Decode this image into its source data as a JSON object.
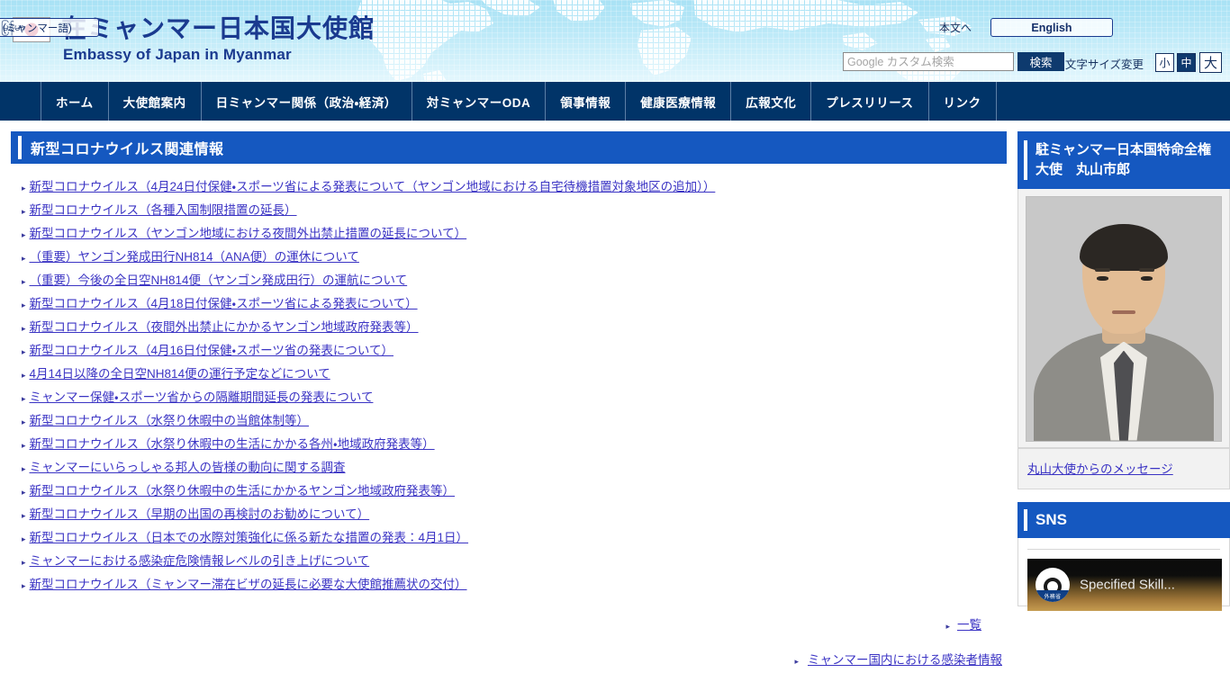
{
  "header": {
    "flag_icon": "japan-flag-icon",
    "title_ja": "在ミャンマー日本国大使館",
    "title_en": "Embassy of Japan in Myanmar",
    "skip_link": "本文へ",
    "lang_english": "English",
    "lang_myanmar_native": "မြန်မာ",
    "lang_myanmar_jp": "(ミャンマー語)",
    "search_placeholder": "Google カスタム検索",
    "search_value": "",
    "search_button": "検索",
    "fontsize_label": "文字サイズ変更",
    "fontsize_small": "小",
    "fontsize_medium": "中",
    "fontsize_large": "大",
    "accent_blue": "#013468",
    "header_bg": "#b9e8f7"
  },
  "nav": {
    "items": [
      {
        "label": "ホーム"
      },
      {
        "label": "大使館案内"
      },
      {
        "label": "日ミャンマー関係（政治・経済）"
      },
      {
        "label": "対ミャンマーODA"
      },
      {
        "label": "領事情報"
      },
      {
        "label": "健康医療情報"
      },
      {
        "label": "広報文化"
      },
      {
        "label": "プレスリリース"
      },
      {
        "label": "リンク"
      }
    ]
  },
  "main": {
    "section_title": "新型コロナウイルス関連情報",
    "section_color": "#1558c0",
    "news": [
      {
        "label": "新型コロナウイルス（4月24日付保健・スポーツ省による発表について（ヤンゴン地域における自宅待機措置対象地区の追加））"
      },
      {
        "label": "新型コロナウイルス（各種入国制限措置の延長）"
      },
      {
        "label": "新型コロナウイルス（ヤンゴン地域における夜間外出禁止措置の延長について）"
      },
      {
        "label": "（重要）ヤンゴン発成田行NH814（ANA便）の運休について"
      },
      {
        "label": "（重要）今後の全日空NH814便（ヤンゴン発成田行）の運航について"
      },
      {
        "label": "新型コロナウイルス（4月18日付保健・スポーツ省による発表について）"
      },
      {
        "label": "新型コロナウイルス（夜間外出禁止にかかるヤンゴン地域政府発表等）"
      },
      {
        "label": "新型コロナウイルス（4月16日付保健・スポーツ省の発表について）"
      },
      {
        "label": "4月14日以降の全日空NH814便の運行予定などについて"
      },
      {
        "label": "ミャンマー保健・スポーツ省からの隔離期間延長の発表について"
      },
      {
        "label": "新型コロナウイルス（水祭り休暇中の当館体制等）"
      },
      {
        "label": "新型コロナウイルス（水祭り休暇中の生活にかかる各州・地域政府発表等）"
      },
      {
        "label": "ミャンマーにいらっしゃる邦人の皆様の動向に関する調査"
      },
      {
        "label": "新型コロナウイルス（水祭り休暇中の生活にかかるヤンゴン地域政府発表等）"
      },
      {
        "label": "新型コロナウイルス（早期の出国の再検討のお勧めについて）"
      },
      {
        "label": "新型コロナウイルス（日本での水際対策強化に係る新たな措置の発表：4月1日）"
      },
      {
        "label": "ミャンマーにおける感染症危険情報レベルの引き上げについて"
      },
      {
        "label": "新型コロナウイルス（ミャンマー滞在ビザの延長に必要な大使館推薦状の交付）"
      }
    ],
    "more_label": "一覧",
    "infection_label": "ミャンマー国内における感染者情報"
  },
  "sidebar": {
    "ambassador": {
      "heading": "駐ミャンマー日本国特命全権大使　丸山市郎",
      "photo_alt": "ambassador-portrait",
      "message_link": "丸山大使からのメッセージ"
    },
    "sns": {
      "heading": "SNS",
      "video_title": "Specified Skill...",
      "logo_label": "外務省"
    }
  }
}
